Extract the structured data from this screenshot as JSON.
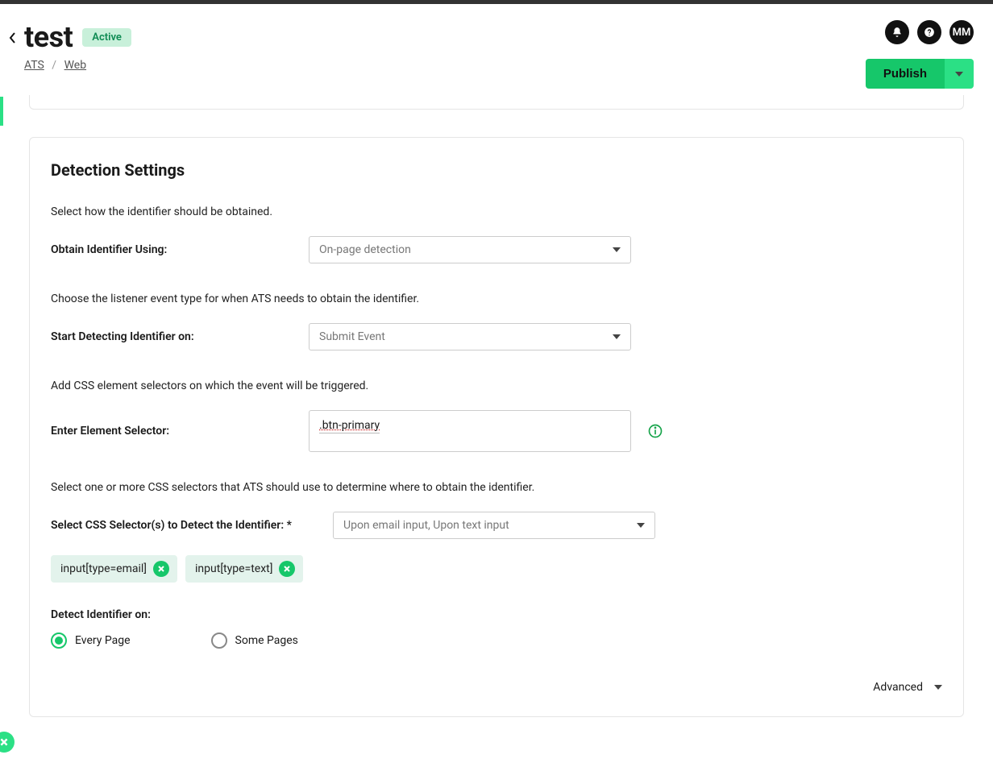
{
  "header": {
    "title": "test",
    "status": "Active",
    "breadcrumb": {
      "root": "ATS",
      "leaf": "Web"
    },
    "publish_label": "Publish",
    "avatar_initials": "MM"
  },
  "card": {
    "heading": "Detection Settings",
    "obtain": {
      "desc": "Select how the identifier should be obtained.",
      "label": "Obtain Identifier Using:",
      "value": "On-page detection"
    },
    "start_detect": {
      "desc": "Choose the listener event type for when ATS needs to obtain the identifier.",
      "label": "Start Detecting Identifier on:",
      "value": "Submit Event"
    },
    "element_selector": {
      "desc": "Add CSS element selectors on which the event will be triggered.",
      "label": "Enter Element Selector:",
      "value": ".btn-primary"
    },
    "css_selectors": {
      "desc": "Select one or more CSS selectors that ATS should use to determine where to obtain the identifier.",
      "label": "Select CSS Selector(s) to Detect the Identifier: *",
      "value": "Upon email input, Upon text input",
      "chips": [
        "input[type=email]",
        "input[type=text]"
      ]
    },
    "detect_on": {
      "label": "Detect Identifier on:",
      "options": [
        "Every Page",
        "Some Pages"
      ],
      "selected": "Every Page"
    },
    "advanced_label": "Advanced"
  }
}
